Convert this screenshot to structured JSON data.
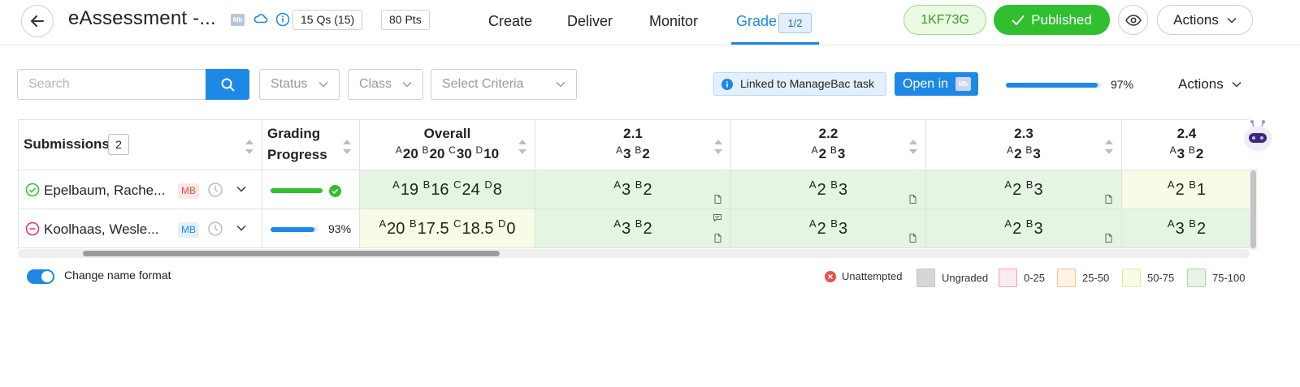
{
  "header": {
    "title": "eAssessment -...",
    "mb_logo": "Mb",
    "questions_pill": "15 Qs (15)",
    "points_pill": "80 Pts",
    "tabs": [
      {
        "label": "Create"
      },
      {
        "label": "Deliver"
      },
      {
        "label": "Monitor"
      },
      {
        "label": "Grade",
        "badge": "1/2",
        "active": true
      }
    ],
    "code": "1KF73G",
    "published_label": "Published",
    "actions_label": "Actions"
  },
  "filters": {
    "search_placeholder": "Search",
    "status_label": "Status",
    "class_label": "Class",
    "criteria_label": "Select Criteria",
    "linked_text": "Linked to ManageBac task",
    "open_in_label": "Open in",
    "open_in_logo": "Mb",
    "progress_fraction": 0.97,
    "progress_label": "97%",
    "actions_label": "Actions"
  },
  "table": {
    "submissions_label": "Submissions",
    "submissions_count": "2",
    "grading_label_1": "Grading",
    "grading_label_2": "Progress",
    "columns": [
      {
        "title": "Overall",
        "sub": [
          [
            "A",
            "20"
          ],
          [
            "B",
            "20"
          ],
          [
            "C",
            "30"
          ],
          [
            "D",
            "10"
          ]
        ]
      },
      {
        "title": "2.1",
        "sub": [
          [
            "A",
            "3"
          ],
          [
            "B",
            "2"
          ]
        ]
      },
      {
        "title": "2.2",
        "sub": [
          [
            "A",
            "2"
          ],
          [
            "B",
            "3"
          ]
        ]
      },
      {
        "title": "2.3",
        "sub": [
          [
            "A",
            "2"
          ],
          [
            "B",
            "3"
          ]
        ]
      },
      {
        "title": "2.4",
        "sub": [
          [
            "A",
            "3"
          ],
          [
            "B",
            "2"
          ]
        ]
      }
    ],
    "rows": [
      {
        "name": "Epelbaum, Rache...",
        "mb_tag": "MB",
        "status": "completed",
        "progress_fraction": 1.0,
        "progress_label": "",
        "cells": [
          [
            [
              "A",
              "19"
            ],
            [
              "B",
              "16"
            ],
            [
              "C",
              "24"
            ],
            [
              "D",
              "8"
            ]
          ],
          [
            [
              "A",
              "3"
            ],
            [
              "B",
              "2"
            ]
          ],
          [
            [
              "A",
              "2"
            ],
            [
              "B",
              "3"
            ]
          ],
          [
            [
              "A",
              "2"
            ],
            [
              "B",
              "3"
            ]
          ],
          [
            [
              "A",
              "2"
            ],
            [
              "B",
              "1"
            ]
          ]
        ]
      },
      {
        "name": "Koolhaas, Wesle...",
        "mb_tag": "MB",
        "status": "unattempted",
        "progress_fraction": 0.93,
        "progress_label": "93%",
        "cells": [
          [
            [
              "A",
              "20"
            ],
            [
              "B",
              "17.5"
            ],
            [
              "C",
              "18.5"
            ],
            [
              "D",
              "0"
            ]
          ],
          [
            [
              "A",
              "3"
            ],
            [
              "B",
              "2"
            ]
          ],
          [
            [
              "A",
              "2"
            ],
            [
              "B",
              "3"
            ]
          ],
          [
            [
              "A",
              "2"
            ],
            [
              "B",
              "3"
            ]
          ],
          [
            [
              "A",
              "3"
            ],
            [
              "B",
              "2"
            ]
          ]
        ]
      }
    ]
  },
  "footer": {
    "toggle_label": "Change name format",
    "legend": [
      {
        "label": "Unattempted"
      },
      {
        "label": "Ungraded",
        "color": "#d6d6d6",
        "border": "#c4c4c4"
      },
      {
        "label": "0-25",
        "color": "#fdecee",
        "border": "#f3a0a8"
      },
      {
        "label": "25-50",
        "color": "#fef3e6",
        "border": "#f7c48f"
      },
      {
        "label": "50-75",
        "color": "#f8fbe5",
        "border": "#dfe8a4"
      },
      {
        "label": "75-100",
        "color": "#e4f5e2",
        "border": "#a8d8a0"
      }
    ]
  },
  "colors": {
    "accent": "#1e88e5",
    "success": "#2fbf2f",
    "danger": "#e5534b"
  }
}
